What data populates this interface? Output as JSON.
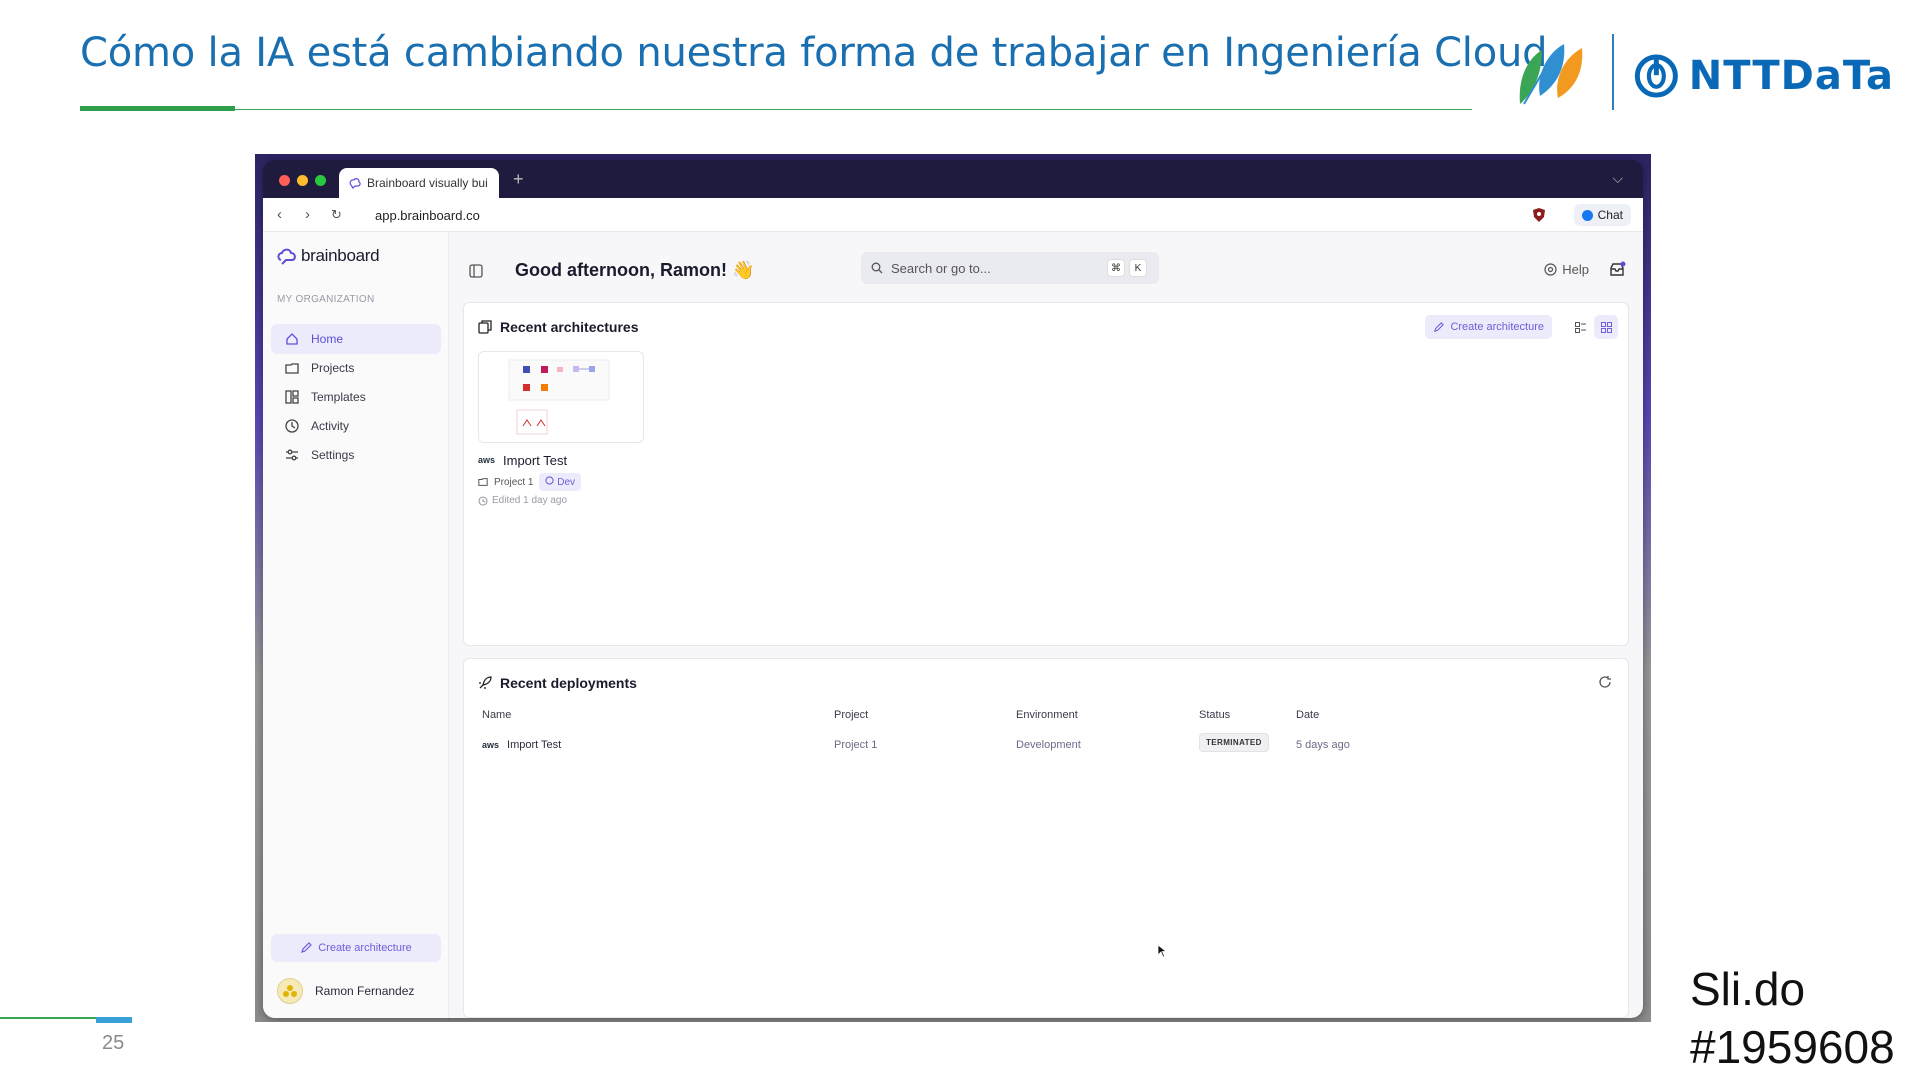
{
  "slide": {
    "title": "Cómo la IA está cambiando nuestra forma de trabajar en Ingeniería Cloud",
    "logo_text": "NTTDaTa",
    "page_number": "25",
    "slido_line1": "Sli.do",
    "slido_line2": "#1959608"
  },
  "browser": {
    "tab_title": "Brainboard visually bui",
    "url": "app.brainboard.co",
    "chat_label": "Chat"
  },
  "sidebar": {
    "brand": "brainboard",
    "org_label": "MY ORGANIZATION",
    "items": [
      {
        "label": "Home",
        "icon": "home-icon"
      },
      {
        "label": "Projects",
        "icon": "folder-icon"
      },
      {
        "label": "Templates",
        "icon": "templates-icon"
      },
      {
        "label": "Activity",
        "icon": "clock-icon"
      },
      {
        "label": "Settings",
        "icon": "settings-icon"
      }
    ],
    "create_label": "Create architecture",
    "user_name": "Ramon Fernandez"
  },
  "header": {
    "greeting": "Good afternoon, Ramon! 👋",
    "search_placeholder": "Search or go to...",
    "kbd_cmd": "⌘",
    "kbd_k": "K",
    "help_label": "Help"
  },
  "recent_architectures": {
    "title": "Recent architectures",
    "create_label": "Create architecture",
    "items": [
      {
        "name": "Import Test",
        "provider": "aws",
        "project": "Project 1",
        "environment": "Dev",
        "edited": "Edited 1 day ago"
      }
    ]
  },
  "recent_deployments": {
    "title": "Recent deployments",
    "columns": [
      "Name",
      "Project",
      "Environment",
      "Status",
      "Date"
    ],
    "rows": [
      {
        "name": "Import Test",
        "provider": "aws",
        "project": "Project 1",
        "environment": "Development",
        "status": "TERMINATED",
        "date": "5 days ago"
      }
    ]
  },
  "colors": {
    "title_blue": "#1a6fb0",
    "accent_green": "#2f9e4a",
    "brand_purple": "#5b4fd8",
    "ntt_blue": "#0a69b6"
  }
}
